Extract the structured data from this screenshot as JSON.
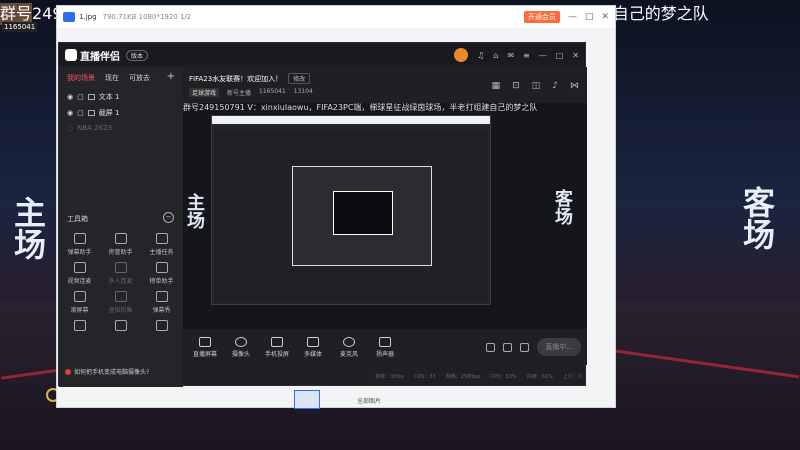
{
  "background": {
    "title": "群号249150791 V：xinxiulaowu，FIFA23PC端，梯球星征战绿茵球场，半老打组建自己的梦之队",
    "viewer_id": "1165041",
    "home_text": "主场",
    "away_text": "客场"
  },
  "viewer": {
    "filename": "1.jpg",
    "meta": "790.71KB  1080*1920  1/2",
    "open_button": "开通会员",
    "footer_label": "全部图片"
  },
  "app": {
    "logo": "直播伴侣",
    "version_badge": "版本",
    "scene_tabs": [
      "我的场景",
      "现在",
      "可放去"
    ],
    "sources": [
      {
        "label": "文本 1",
        "enabled": true
      },
      {
        "label": "截屏 1",
        "enabled": true
      },
      {
        "label": "NBA 2K23",
        "enabled": false
      }
    ],
    "tools_heading": "工具箱",
    "tools": [
      {
        "label": "弹幕助手",
        "dim": false
      },
      {
        "label": "房管助手",
        "dim": false
      },
      {
        "label": "主播任务",
        "dim": false
      },
      {
        "label": "视频连麦",
        "dim": false
      },
      {
        "label": "多人连麦",
        "dim": true
      },
      {
        "label": "榜单助手",
        "dim": false
      },
      {
        "label": "滚屏幕",
        "dim": false
      },
      {
        "label": "虚拟形象",
        "dim": true
      },
      {
        "label": "弹幕秀",
        "dim": false
      },
      {
        "label": "",
        "dim": false
      },
      {
        "label": "",
        "dim": false
      },
      {
        "label": "",
        "dim": false
      }
    ],
    "tip": "如何把手机变成电脑摄像头?",
    "room": {
      "title": "FIFA23水友联赛！欢迎加入！",
      "edit_label": "修改",
      "game_tag": "足球游戏",
      "subtitle": "新号主播",
      "room_id": "1165041",
      "followers": "13104"
    },
    "preview": {
      "title": "群号249150791 V：xinxiulaowu，FIFA23PC端，梯球星征战绿茵球场，半老打组建自己的梦之队",
      "home_text": "主场",
      "away_text": "客场"
    },
    "bottom_buttons": [
      "直播屏幕",
      "摄像头",
      "手机投屏",
      "多媒体",
      "麦克风",
      "扬声器"
    ],
    "live_button": "直播中...",
    "status": [
      "帧率：30fps",
      "CPU：33",
      "网络：25Mbps",
      "CPU：53%",
      "内存：61%",
      "上行：0"
    ]
  }
}
